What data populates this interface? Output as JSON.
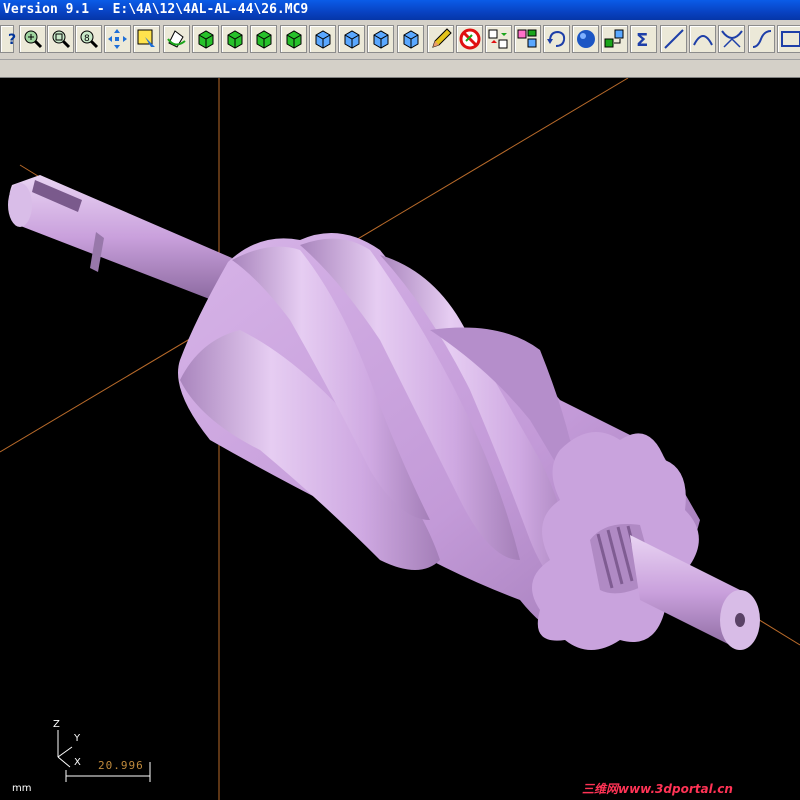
{
  "window": {
    "title": "Version 9.1 - E:\\4A\\12\\4AL-AL-44\\26.MC9"
  },
  "toolbar": {
    "buttons": [
      {
        "name": "help-button",
        "icon": "help-icon"
      },
      {
        "name": "zoom-in-button",
        "icon": "zoom-in-icon"
      },
      {
        "name": "zoom-window-button",
        "icon": "zoom-window-icon"
      },
      {
        "name": "zoom-fit-button",
        "icon": "zoom-fit-icon"
      },
      {
        "name": "pan-button",
        "icon": "pan-arrows-icon"
      },
      {
        "name": "select-button",
        "icon": "select-icon"
      },
      {
        "name": "rotate-view-button",
        "icon": "rotate-view-icon"
      },
      {
        "name": "view-top-button",
        "icon": "cube-green-icon"
      },
      {
        "name": "view-front-button",
        "icon": "cube-green-icon"
      },
      {
        "name": "view-side-button",
        "icon": "cube-green-icon"
      },
      {
        "name": "view-iso-button",
        "icon": "cube-green-icon"
      },
      {
        "name": "cplane-top-button",
        "icon": "cube-blue-icon"
      },
      {
        "name": "cplane-front-button",
        "icon": "cube-blue-icon"
      },
      {
        "name": "cplane-side-button",
        "icon": "cube-blue-icon"
      },
      {
        "name": "cplane-iso-button",
        "icon": "cube-blue-icon"
      },
      {
        "name": "clear-colors-button",
        "icon": "pencil-icon"
      },
      {
        "name": "blank-button",
        "icon": "no-entry-icon"
      },
      {
        "name": "levels-button",
        "icon": "levels-icon"
      },
      {
        "name": "groups-button",
        "icon": "groups-icon"
      },
      {
        "name": "undo-button",
        "icon": "undo-arrow-icon"
      },
      {
        "name": "shading-button",
        "icon": "sphere-icon"
      },
      {
        "name": "regen-button",
        "icon": "regen-icon"
      },
      {
        "name": "analyze-button",
        "icon": "sigma-icon"
      },
      {
        "name": "line-button",
        "icon": "line-icon"
      },
      {
        "name": "arc-button",
        "icon": "arc-icon"
      },
      {
        "name": "fillet-button",
        "icon": "fillet-icon"
      },
      {
        "name": "spline-button",
        "icon": "spline-icon"
      },
      {
        "name": "rectangle-button",
        "icon": "rectangle-icon"
      }
    ]
  },
  "viewport": {
    "background": "#000000",
    "model_color": "#c8a0dc",
    "axis_color": "#b86a2a",
    "axis_labels": {
      "z": "Z",
      "y": "Y",
      "x": "X"
    },
    "scale_value": "20.996",
    "units": "mm"
  },
  "watermark": "三维网www.3dportal.cn"
}
